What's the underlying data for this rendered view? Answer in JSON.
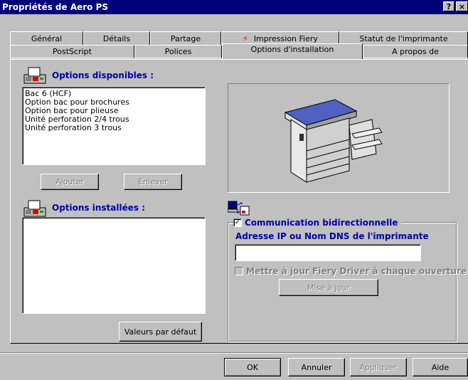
{
  "window": {
    "title": "Propriétés de Aero PS",
    "help_button": "?",
    "close_button": "×"
  },
  "tabs_row1": [
    {
      "label": "Général"
    },
    {
      "label": "Détails"
    },
    {
      "label": "Partage"
    },
    {
      "label": "Impression Fiery"
    },
    {
      "label": "Statut de l'imprimante"
    }
  ],
  "tabs_row2": [
    {
      "label": "PostScript"
    },
    {
      "label": "Polices"
    },
    {
      "label": "Options d'installation",
      "active": true
    },
    {
      "label": "A propos de"
    }
  ],
  "available_options": {
    "heading": "Options disponibles :",
    "items": [
      "Bac 6 (HCF)",
      "Option bac pour brochures",
      "Option bac pour plieuse",
      "Unité perforation 2/4 trous",
      "Unité perforation 3 trous"
    ],
    "add_button": "Ajouter",
    "remove_button": "Enlever"
  },
  "installed_options": {
    "heading": "Options installées :",
    "items": [],
    "defaults_button": "Valeurs par défaut"
  },
  "communication": {
    "checkbox_label": "Communication bidirectionnelle",
    "checkbox_checked": true,
    "ip_label": "Adresse IP ou Nom DNS de l'imprimante",
    "ip_value": "",
    "update_checkbox_label": "Mettre à jour Fiery Driver à chaque ouverture",
    "update_checkbox_checked": false,
    "update_button": "Mise à jour"
  },
  "footer": {
    "ok": "OK",
    "cancel": "Annuler",
    "apply": "Appliquer",
    "help": "Aide"
  }
}
